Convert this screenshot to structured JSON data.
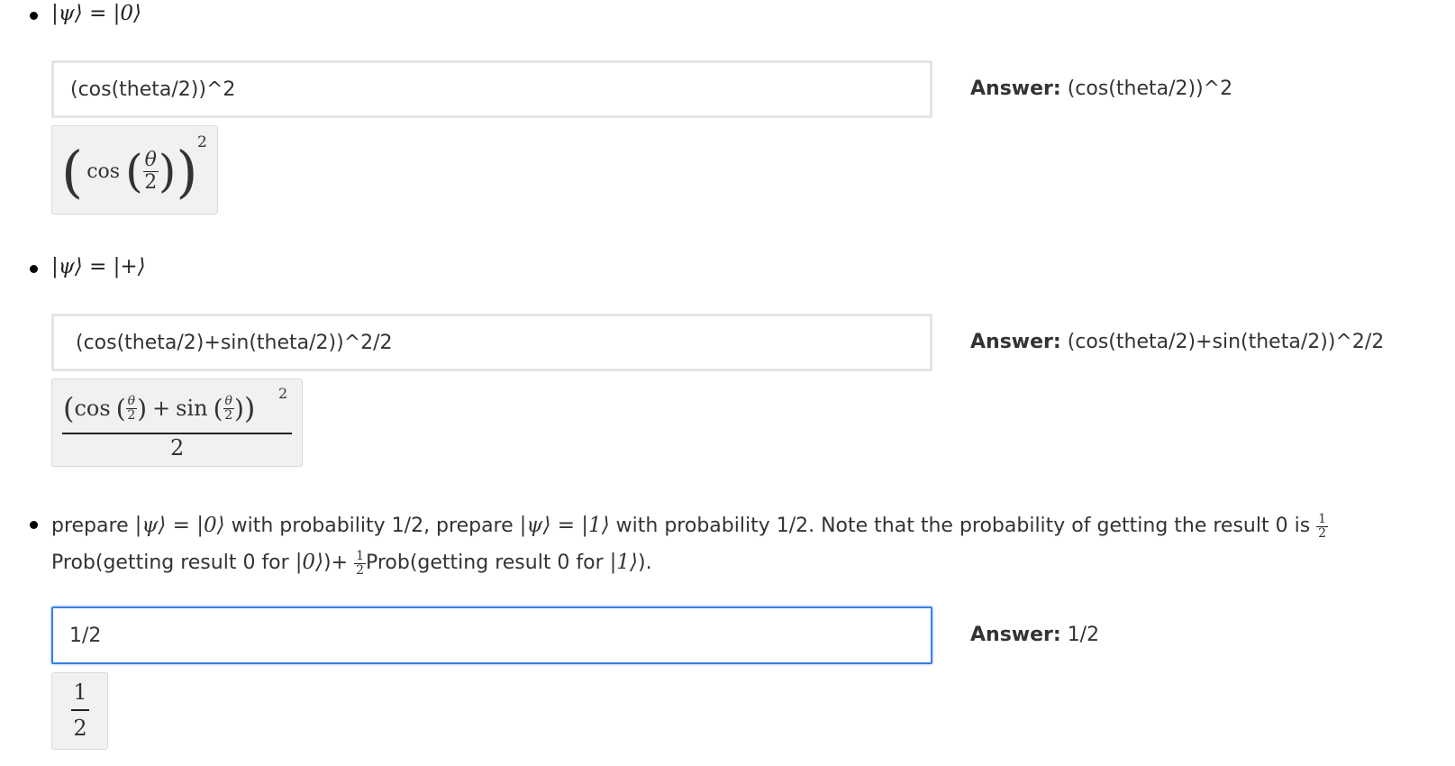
{
  "items": [
    {
      "question_math": "|ψ⟩ = |0⟩",
      "input_value": "(cos(theta/2))^2",
      "answer_label": "Answer:",
      "answer_value": "(cos(theta/2))^2",
      "preview_text": {
        "fn": "cos",
        "num": "θ",
        "den": "2",
        "exp": "2"
      }
    },
    {
      "question_math": "|ψ⟩ = |+⟩",
      "input_value": "(cos(theta/2)+sin(theta/2))^2/2",
      "answer_label": "Answer:",
      "answer_value": "(cos(theta/2)+sin(theta/2))^2/2",
      "preview_text": {
        "fn1": "cos",
        "fn2": "sin",
        "num": "θ",
        "den": "2",
        "exp": "2",
        "plus": "+",
        "outer_den": "2"
      }
    },
    {
      "q_part1": "prepare ",
      "q_math1": "|ψ⟩ = |0⟩",
      "q_part2": " with probability 1/2, prepare ",
      "q_math2": "|ψ⟩ = |1⟩",
      "q_part3": " with probability 1/2. Note that the probability of getting the result 0 is ",
      "q_frac_num": "1",
      "q_frac_den": "2",
      "q_part4": "Prob(getting result 0 for ",
      "q_math3": "|0⟩",
      "q_part5": ")+ ",
      "q_part6": "Prob(getting result 0 for ",
      "q_math4": "|1⟩",
      "q_part7": ").",
      "input_value": "1/2",
      "answer_label": "Answer:",
      "answer_value": "1/2",
      "preview_text": {
        "num": "1",
        "den": "2"
      }
    }
  ],
  "colors": {
    "focus": "#3a7ee0",
    "input_border": "#e4e4e4",
    "preview_bg": "#f1f1f1"
  }
}
